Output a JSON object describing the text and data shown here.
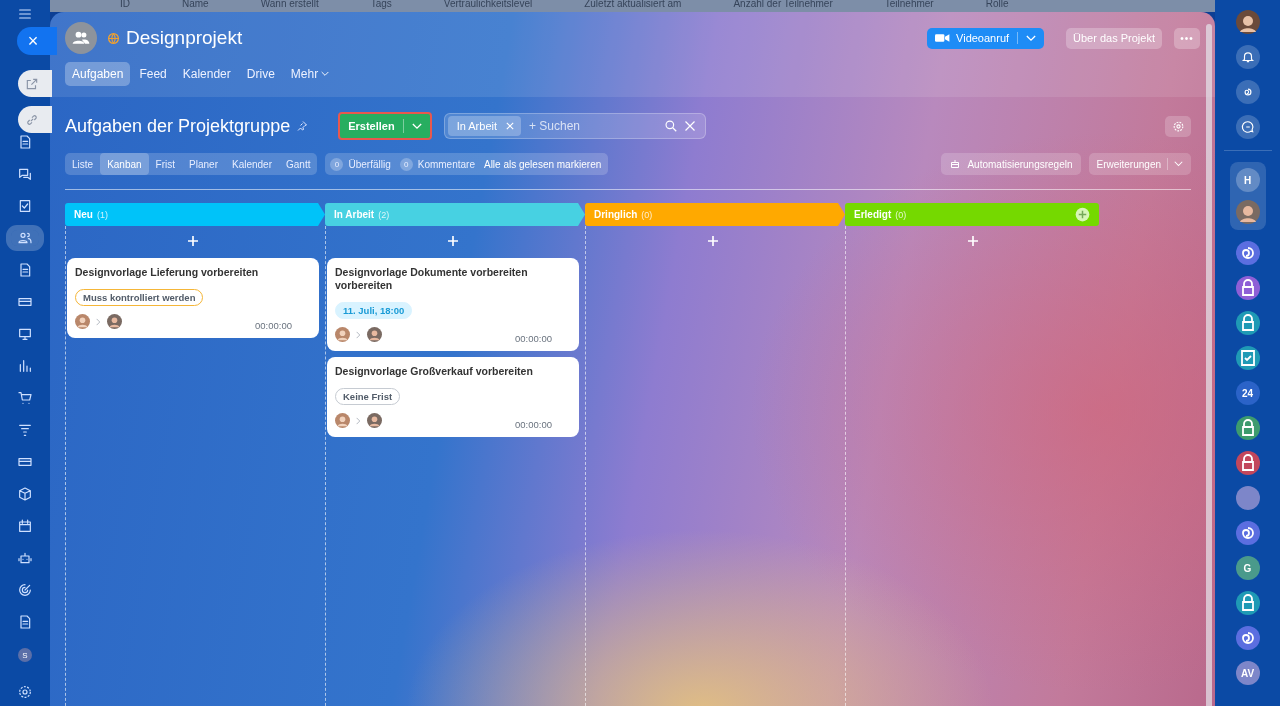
{
  "background_table": {
    "columns": [
      "ID",
      "Name",
      "Wann erstellt",
      "Tags",
      "Vertraulichkeitslevel",
      "Zuletzt aktualisiert am",
      "Anzahl der Teilnehmer",
      "Teilnehmer",
      "Rolle"
    ]
  },
  "left_sidebar": {
    "items": [
      {
        "kind": "menu",
        "selected": false
      },
      {
        "kind": "doc",
        "selected": false
      },
      {
        "kind": "chat",
        "selected": false
      },
      {
        "kind": "check",
        "selected": false
      },
      {
        "kind": "team",
        "selected": true
      },
      {
        "kind": "doc",
        "selected": false
      },
      {
        "kind": "card",
        "selected": false
      },
      {
        "kind": "video",
        "selected": false
      },
      {
        "kind": "chart",
        "selected": false
      },
      {
        "kind": "cart",
        "selected": false
      },
      {
        "kind": "filter",
        "selected": false
      },
      {
        "kind": "card",
        "selected": false
      },
      {
        "kind": "box",
        "selected": false
      },
      {
        "kind": "calendar",
        "selected": false
      },
      {
        "kind": "robot",
        "selected": false
      },
      {
        "kind": "target",
        "selected": false
      },
      {
        "kind": "doc",
        "selected": false
      }
    ],
    "user_badge": "S"
  },
  "side_tabs": {
    "close": "×"
  },
  "project": {
    "title": "Designprojekt",
    "buttons": {
      "video": "Videoanruf",
      "about": "Über das Projekt",
      "more": "•••"
    },
    "tabs": [
      {
        "label": "Aufgaben",
        "selected": true
      },
      {
        "label": "Feed",
        "selected": false
      },
      {
        "label": "Kalender",
        "selected": false
      },
      {
        "label": "Drive",
        "selected": false
      },
      {
        "label": "Mehr",
        "selected": false
      }
    ]
  },
  "toolbar": {
    "title": "Aufgaben der Projektgruppe",
    "create": "Erstellen",
    "filter_chip": "In Arbeit",
    "search_placeholder": "+ Suchen",
    "views": [
      {
        "label": "Liste",
        "selected": false
      },
      {
        "label": "Kanban",
        "selected": true
      },
      {
        "label": "Frist",
        "selected": false
      },
      {
        "label": "Planer",
        "selected": false
      },
      {
        "label": "Kalender",
        "selected": false
      },
      {
        "label": "Gantt",
        "selected": false
      }
    ],
    "counters": [
      {
        "count": "0",
        "label": "Überfällig"
      },
      {
        "count": "0",
        "label": "Kommentare"
      }
    ],
    "mark_read": "Alle als gelesen markieren",
    "automation": "Automatisierungsregeln",
    "extensions": "Erweiterungen"
  },
  "columns": [
    {
      "name": "Neu",
      "count": "(1)",
      "color": "#00c3f9",
      "add_button": false,
      "cards": [
        {
          "title": "Designvorlage Lieferung vorbereiten",
          "tag": {
            "kind": "warning",
            "text": "Muss kontrolliert werden"
          },
          "time": "00:00:00"
        }
      ]
    },
    {
      "name": "In Arbeit",
      "count": "(2)",
      "color": "#47d1e2",
      "add_button": false,
      "cards": [
        {
          "title": "Designvorlage Dokumente vorbereiten vorbereiten",
          "tag": {
            "kind": "deadline",
            "text": "11. Juli, 18:00"
          },
          "time": "00:00:00"
        },
        {
          "title": "Designvorlage Großverkauf vorbereiten",
          "tag": {
            "kind": "plain",
            "text": "Keine Frist"
          },
          "time": "00:00:00"
        }
      ]
    },
    {
      "name": "Dringlich",
      "count": "(0)",
      "color": "#ffa900",
      "add_button": false
    },
    {
      "name": "Erledigt",
      "count": "(0)",
      "color": "#75d900",
      "add_button": true
    }
  ],
  "right_sidebar": {
    "items": [
      {
        "kind": "spiral",
        "color": "#5b6ee0"
      },
      {
        "kind": "lock",
        "color": "#8e5fd6"
      },
      {
        "kind": "lock",
        "color": "#1f9ab5"
      },
      {
        "kind": "check",
        "color": "#1f9ab5"
      },
      {
        "kind": "text",
        "label": "24",
        "color": "#2b63c8"
      },
      {
        "kind": "lock",
        "color": "#3d9b6e"
      },
      {
        "kind": "lock",
        "color": "#c2475c"
      },
      {
        "kind": "blank",
        "color": "#7d86c9"
      },
      {
        "kind": "spiral",
        "color": "#5b6ee0"
      },
      {
        "kind": "text",
        "label": "G",
        "color": "#4a9a8b"
      },
      {
        "kind": "lock",
        "color": "#1f9ab5"
      },
      {
        "kind": "spiral",
        "color": "#5b6ee0"
      },
      {
        "kind": "text",
        "label": "AV",
        "color": "#7d86c9"
      }
    ],
    "group_letter": "H"
  }
}
